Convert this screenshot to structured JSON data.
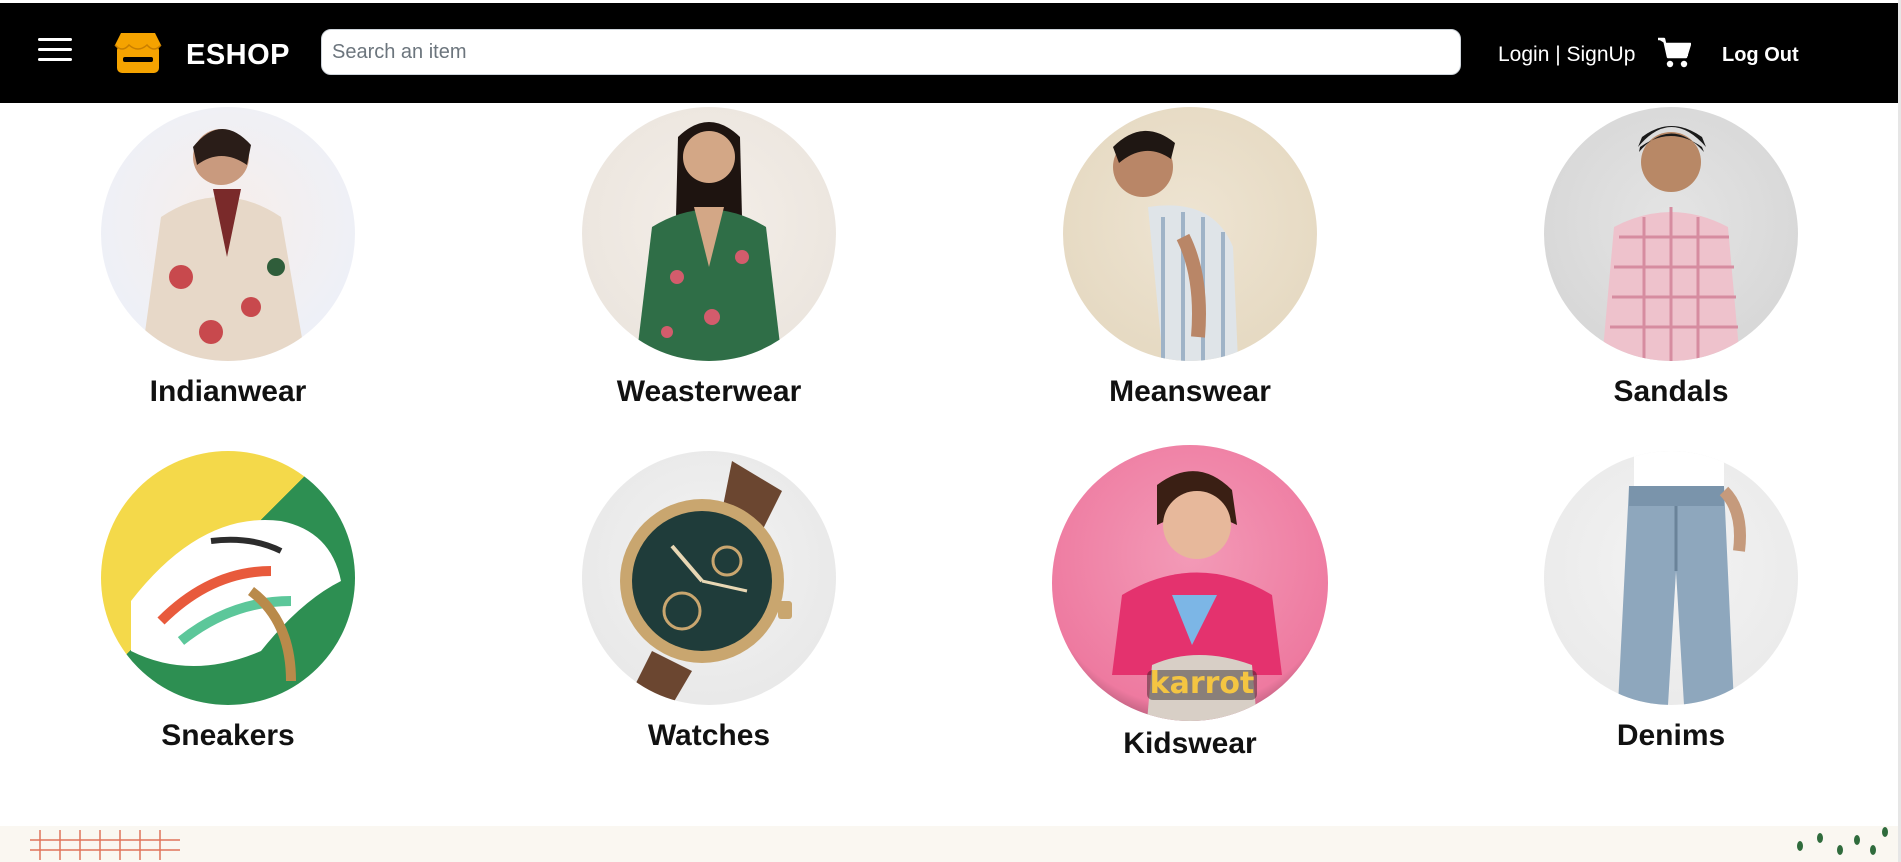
{
  "header": {
    "brand": "ESHOP",
    "search_placeholder": "Search an item",
    "search_value": "",
    "login_link": "Login | SignUp",
    "logout_label": "Log Out"
  },
  "colors": {
    "navbar_bg": "#000000",
    "logo_accent": "#f5a300",
    "page_bg": "#ffffff"
  },
  "icons": {
    "menu": "hamburger-menu-icon",
    "logo": "store-icon",
    "cart": "shopping-cart-icon"
  },
  "categories": [
    {
      "label": "Indianwear"
    },
    {
      "label": "Weasterwear"
    },
    {
      "label": "Meanswear"
    },
    {
      "label": "Sandals"
    },
    {
      "label": "Sneakers"
    },
    {
      "label": "Watches"
    },
    {
      "label": "Kidswear"
    },
    {
      "label": "Denims"
    }
  ]
}
